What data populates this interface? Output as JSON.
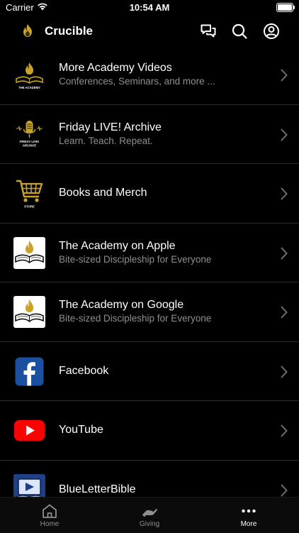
{
  "status_bar": {
    "carrier": "Carrier",
    "time": "10:54 AM"
  },
  "header": {
    "title": "Crucible"
  },
  "items": [
    {
      "title": "More Academy Videos",
      "subtitle": "Conferences, Seminars, and more ...",
      "thumb_caption": "THE ACADEMY",
      "icon": "academy-flame-book-icon"
    },
    {
      "title": "Friday LIVE! Archive",
      "subtitle": "Learn. Teach. Repeat.",
      "thumb_caption": "FRIDAY LIVE! ARCHIVE",
      "icon": "microphone-icon"
    },
    {
      "title": "Books and Merch",
      "subtitle": "",
      "thumb_caption": "STORE",
      "icon": "shopping-cart-icon"
    },
    {
      "title": "The Academy on Apple",
      "subtitle": "Bite-sized Discipleship for Everyone",
      "icon": "academy-flame-book-icon"
    },
    {
      "title": "The Academy on Google",
      "subtitle": "Bite-sized Discipleship for Everyone",
      "icon": "academy-flame-book-icon"
    },
    {
      "title": "Facebook",
      "subtitle": "",
      "icon": "facebook-icon"
    },
    {
      "title": "YouTube",
      "subtitle": "",
      "icon": "youtube-icon"
    },
    {
      "title": "BlueLetterBible",
      "subtitle": "",
      "icon": "blueletterbible-icon"
    }
  ],
  "tabs": [
    {
      "label": "Home",
      "icon": "home-icon",
      "active": false
    },
    {
      "label": "Giving",
      "icon": "giving-hand-icon",
      "active": false
    },
    {
      "label": "More",
      "icon": "more-dots-icon",
      "active": true
    }
  ],
  "colors": {
    "background": "#000000",
    "gold": "#c9a227",
    "subtitle": "#8e8e93",
    "facebook": "#1b4fa0",
    "youtube": "#ff0000"
  }
}
